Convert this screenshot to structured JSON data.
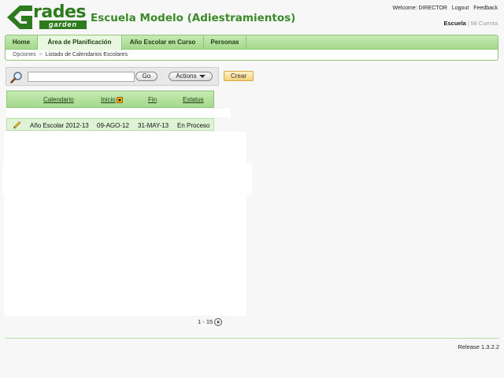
{
  "header": {
    "logo_main": "rades",
    "logo_sub": "garden",
    "app_title": "Escuela Modelo (Adiestramientos)",
    "welcome": "Welcome: DIRECTOR",
    "logout": "Logout",
    "feedback": "Feedback",
    "context_active": "Escuela",
    "context_separator": "|",
    "context_inactive": "Mi Cuenta"
  },
  "tabs": [
    {
      "label": "Home"
    },
    {
      "label": "Área de Planificación",
      "active": true
    },
    {
      "label": "Año Escolar en Curso"
    },
    {
      "label": "Personas"
    }
  ],
  "breadcrumb": {
    "parent": "Opciones",
    "arrow": ">",
    "current": "Listado de Calendarios Escolares"
  },
  "search": {
    "value": "",
    "go_label": "Go",
    "actions_label": "Actions",
    "create_label": "Crear"
  },
  "table": {
    "columns": [
      "Calendario",
      "Inicio",
      "Fin",
      "Estatus"
    ],
    "rows": [
      {
        "calendario": "Año Escolar 2012-13",
        "inicio": "09-AGO-12",
        "fin": "31-MAY-13",
        "estatus": "En Proceso"
      }
    ]
  },
  "pagination": {
    "range": "1 - 15"
  },
  "footer": {
    "release": "Release 1.3.2.2"
  },
  "colors": {
    "brand_green": "#2e7a1e",
    "title_green": "#3d8a2a",
    "tab_gradient_top": "#c6eab4",
    "tab_gradient_bottom": "#a4d98b",
    "row_highlight": "#ddf3d3",
    "create_button": "#f5d37c"
  },
  "icons": {
    "logo": "grades-garden-logo",
    "search": "magnifier-icon",
    "sort": "sort-descending-icon",
    "edit": "pencil-icon",
    "next": "next-page-icon"
  }
}
